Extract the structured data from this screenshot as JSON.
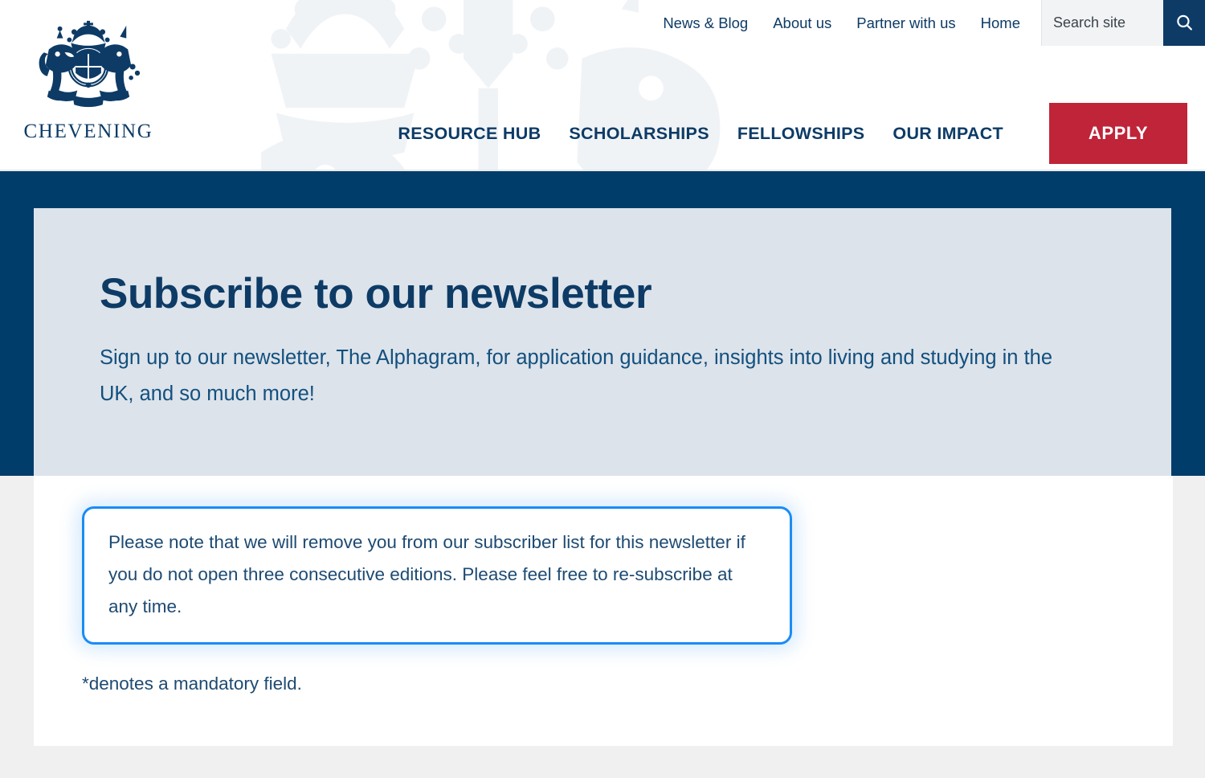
{
  "site": {
    "brand_name": "CHEVENING",
    "crest_icon": "royal-coat-of-arms-icon",
    "watermark_icon": "royal-coat-of-arms-watermark-icon"
  },
  "header": {
    "utility_links": [
      {
        "label": "News & Blog"
      },
      {
        "label": "About us"
      },
      {
        "label": "Partner with us"
      },
      {
        "label": "Home"
      }
    ],
    "search": {
      "placeholder": "Search site",
      "value": "",
      "button_icon": "search-icon"
    },
    "nav_links": [
      {
        "label": "RESOURCE HUB"
      },
      {
        "label": "SCHOLARSHIPS"
      },
      {
        "label": "FELLOWSHIPS"
      },
      {
        "label": "OUR IMPACT"
      }
    ],
    "apply_label": "APPLY"
  },
  "hero": {
    "title": "Subscribe to our newsletter",
    "subtitle": "Sign up to our newsletter, The Alphagram, for application guidance, insights into living and studying in the UK, and so much more!"
  },
  "main": {
    "notice": "Please note that we will remove you from our subscriber list for this newsletter if you do not open three consecutive editions. Please feel free to re-subscribe at any time.",
    "mandatory_note": "*denotes a mandatory field."
  },
  "colors": {
    "navy": "#003d6b",
    "brand_blue": "#0d3b66",
    "apply_red": "#bf2438",
    "hero_card": "#dde3ea",
    "focus_blue": "#1a8cf5",
    "page_background": "#f0f0f0"
  }
}
